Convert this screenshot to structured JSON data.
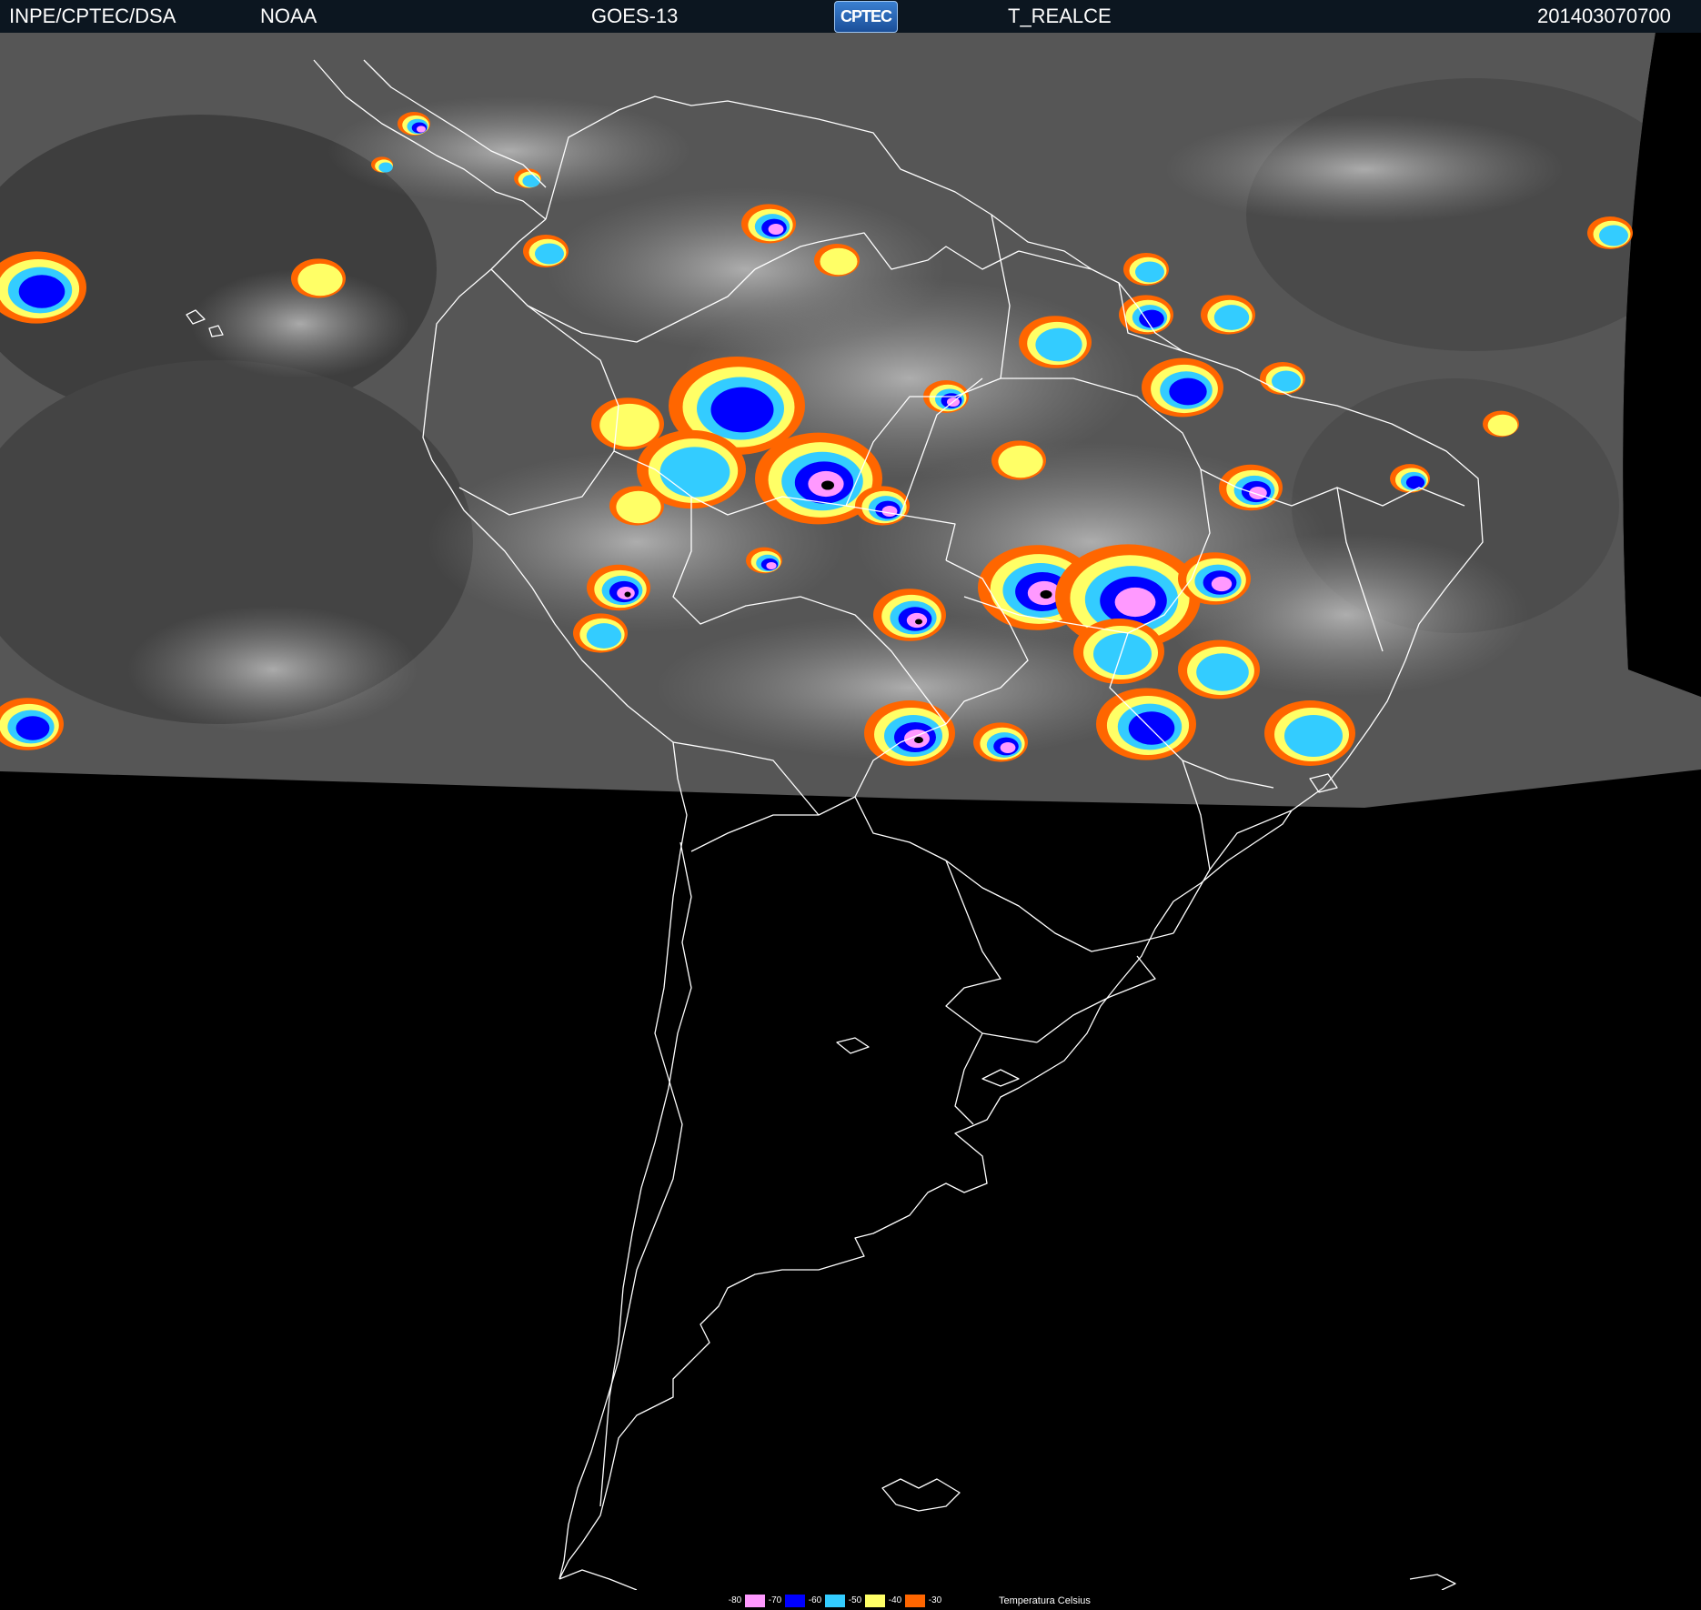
{
  "header": {
    "org": "INPE/CPTEC/DSA",
    "agency": "NOAA",
    "satellite": "GOES-13",
    "logo_text": "CPTEC",
    "product": "T_REALCE",
    "datetime": "201403070700"
  },
  "legend": {
    "caption": "Temperatura   Celsius",
    "scale": [
      {
        "label": "-80",
        "color": "#ff99ff"
      },
      {
        "label": "-70",
        "color": "#0000ff"
      },
      {
        "label": "-60",
        "color": "#33ccff"
      },
      {
        "label": "-50",
        "color": "#ffff66"
      },
      {
        "label": "-40",
        "color": "#ff6600"
      },
      {
        "label": "-30",
        "color": ""
      }
    ]
  },
  "colors": {
    "header_bg": "#0c1620",
    "cloud_gray": "#5a5a5a",
    "night_black": "#000000",
    "borders": "#ffffff"
  }
}
